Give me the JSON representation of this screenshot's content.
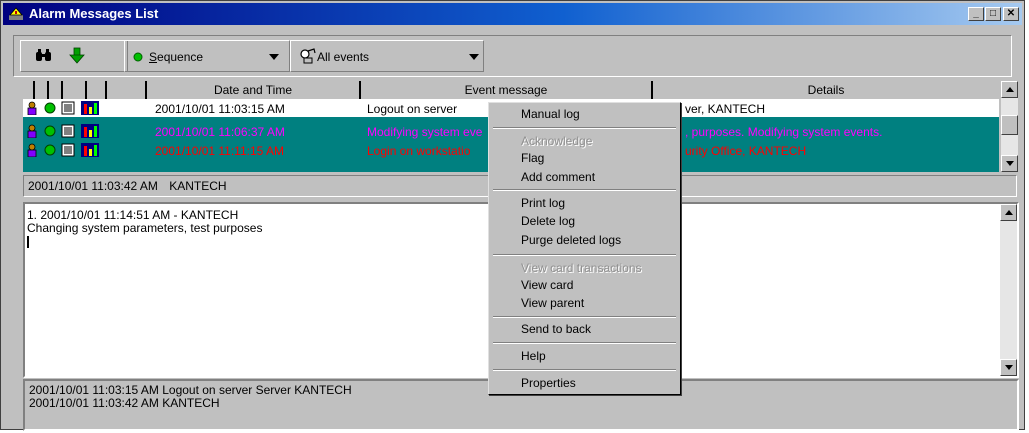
{
  "window": {
    "title": "Alarm Messages List"
  },
  "toolbar": {
    "sort_combo": "Sequence",
    "sort_combo_accesskey": "S",
    "sort_combo_rest": "equence",
    "filter_combo": "All events"
  },
  "columns": [
    "Date and Time",
    "Event message",
    "Details"
  ],
  "rows": [
    {
      "date": "2001/10/01 11:03:15 AM",
      "event": "Logout on server",
      "details": "Server, KANTECH",
      "details_visible": "ver, KANTECH",
      "color": "#000000",
      "selected": false
    },
    {
      "date": "2001/10/01 11:06:37 AM",
      "event": "Modifying system events",
      "event_visible": "Modifying system eve",
      "details": "purposes. Modifying system events",
      "details_visible": ", purposes. Modifying system events.",
      "color": "#ff00ff",
      "selected": true
    },
    {
      "date": "2001/10/01 11:11:15 AM",
      "event": "Login on workstation",
      "event_visible": "Login on workstatio",
      "details": "Security Office, KANTECH",
      "details_visible": "urity Office, KANTECH",
      "color": "#ff0000",
      "selected": true
    }
  ],
  "status_line": {
    "timestamp": "2001/10/01 11:03:42 AM",
    "operator": "KANTECH"
  },
  "notes": {
    "line1": "1. 2001/10/01 11:14:51 AM - KANTECH",
    "line2": "Changing system parameters, test purposes"
  },
  "bottom": {
    "line1": "2001/10/01 11:03:15 AM  Logout on server  Server KANTECH",
    "line2": "2001/10/01 11:03:42 AM    KANTECH"
  },
  "context_menu": [
    {
      "label": "Manual log",
      "enabled": true
    },
    {
      "label": "Acknowledge",
      "enabled": false
    },
    {
      "label": "Flag",
      "enabled": true
    },
    {
      "label": "Add comment",
      "enabled": true
    },
    {
      "label": "Print log",
      "enabled": true
    },
    {
      "label": "Delete log",
      "enabled": true
    },
    {
      "label": "Purge deleted logs",
      "enabled": true
    },
    {
      "label": "View card transactions",
      "enabled": false
    },
    {
      "label": "View card",
      "enabled": true
    },
    {
      "label": "View parent",
      "enabled": true
    },
    {
      "label": "Send to back",
      "enabled": true
    },
    {
      "label": "Help",
      "enabled": true
    },
    {
      "label": "Properties",
      "enabled": true
    }
  ],
  "colors": {
    "title_start": "#000080",
    "selection": "#008080",
    "event_magenta": "#ff00ff",
    "event_red": "#ff0000"
  },
  "icons": [
    "find-binoculars-icon",
    "arrow-down-icon",
    "status-dot-icon",
    "all-events-icon",
    "user-icon",
    "grid-icon"
  ]
}
